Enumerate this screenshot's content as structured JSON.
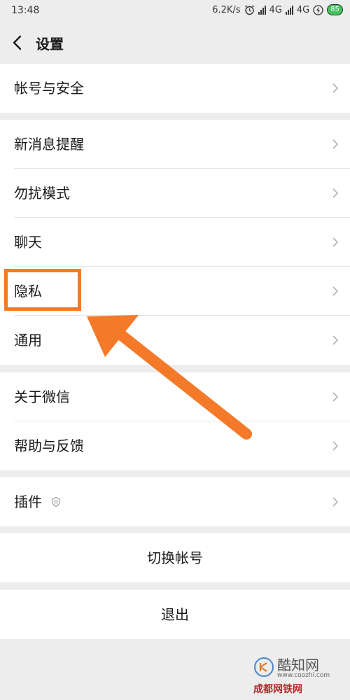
{
  "status_bar": {
    "time": "13:48",
    "speed": "6.2K/s",
    "network1": "4G",
    "network2": "4G",
    "battery": "85"
  },
  "header": {
    "title": "设置"
  },
  "settings": {
    "account_security": "帐号与安全",
    "new_message_alerts": "新消息提醒",
    "do_not_disturb": "勿扰模式",
    "chat": "聊天",
    "privacy": "隐私",
    "general": "通用",
    "about_wechat": "关于微信",
    "help_feedback": "帮助与反馈",
    "plugins": "插件"
  },
  "actions": {
    "switch_account": "切换帐号",
    "logout": "退出"
  },
  "annotation": {
    "highlight_color": "#f47a2a"
  },
  "watermark": {
    "main": "酷知网",
    "url": "www.coozhi.com",
    "sub": "成都网铁网"
  },
  "colors": {
    "background": "#ededed",
    "row_background": "#ffffff",
    "battery": "#43c35e"
  }
}
